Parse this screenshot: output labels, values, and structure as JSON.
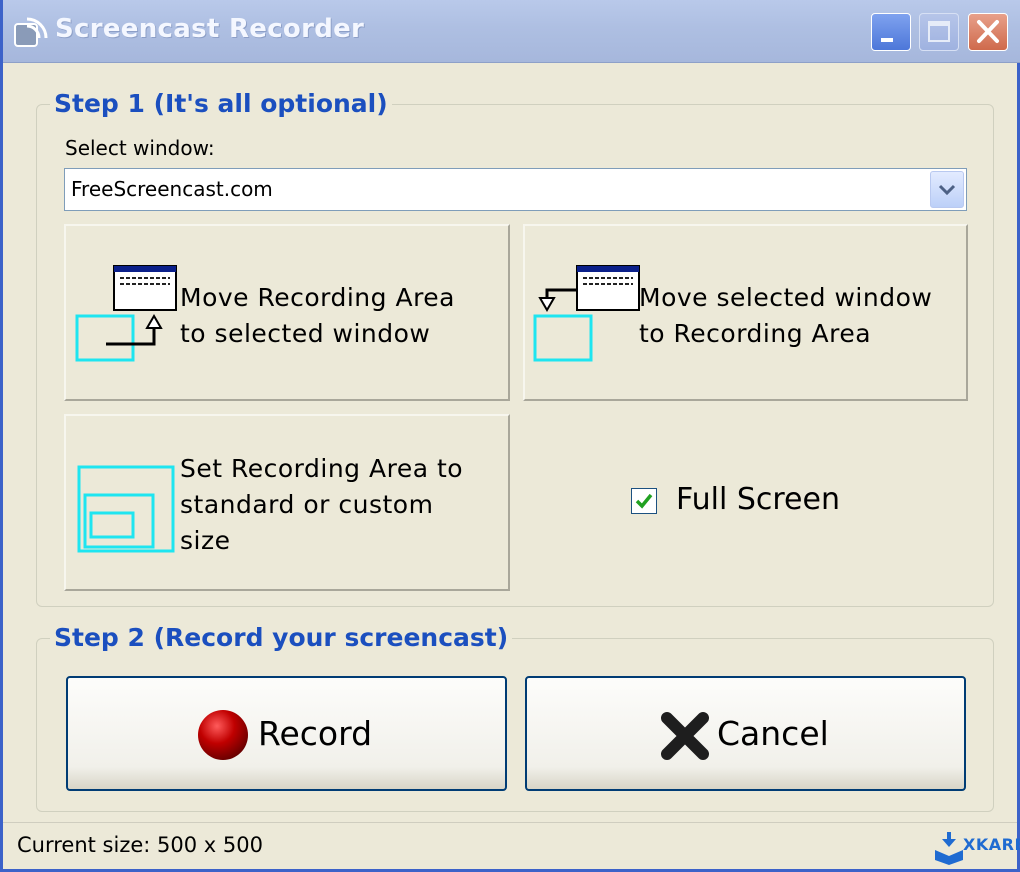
{
  "window": {
    "title": "Screencast Recorder",
    "controls": {
      "minimize": "minimize-icon",
      "maximize": "maximize-icon",
      "close": "close-icon"
    }
  },
  "step1": {
    "title": "Step 1 (It's all optional)",
    "select_label": "Select window:",
    "select_value": "FreeScreencast.com",
    "tiles": [
      {
        "lines": [
          "Move Recording Area",
          "to selected window"
        ],
        "icon": "move-area-to-window-icon"
      },
      {
        "lines": [
          "Move selected window",
          "to Recording Area"
        ],
        "icon": "move-window-to-area-icon"
      },
      {
        "lines": [
          "Set Recording Area to",
          "standard or custom",
          "size"
        ],
        "icon": "area-size-icon"
      }
    ],
    "fullscreen": {
      "label": "Full Screen",
      "checked": true
    }
  },
  "step2": {
    "title": "Step 2 (Record your screencast)",
    "record_label": "Record",
    "cancel_label": "Cancel"
  },
  "status": {
    "text": "Current size:  500 x 500"
  },
  "watermark": {
    "text": "XKARE"
  },
  "colors": {
    "group_title": "#1b4fbf",
    "accent_cyan": "#1ee5f0",
    "record_red": "#c00000",
    "title_bar": "#aebfe2"
  }
}
